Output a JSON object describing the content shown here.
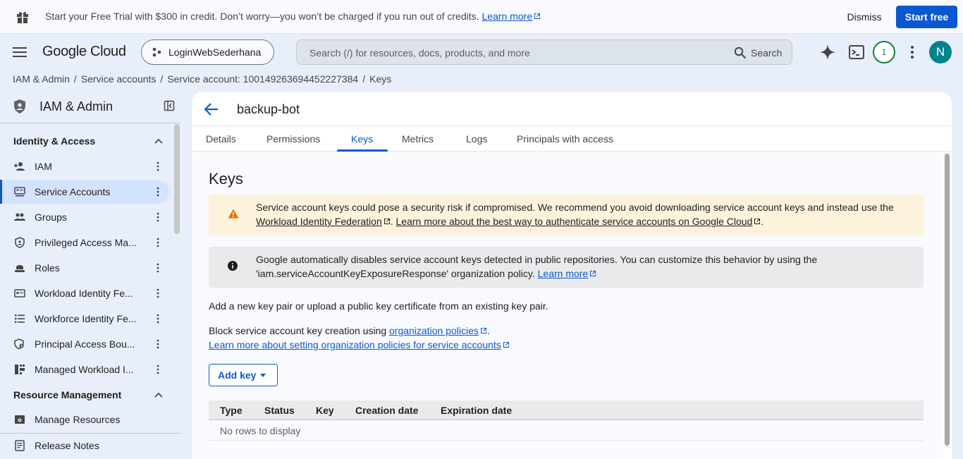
{
  "banner": {
    "text": "Start your Free Trial with $300 in credit. Don’t worry—you won’t be charged if you run out of credits.",
    "link": "Learn more",
    "dismiss": "Dismiss",
    "start": "Start free"
  },
  "header": {
    "logo": "Google Cloud",
    "project": "LoginWebSederhana",
    "search_placeholder": "Search (/) for resources, docs, products, and more",
    "search_button": "Search",
    "notifications": "1",
    "avatar": "N"
  },
  "breadcrumb": [
    "IAM & Admin",
    "Service accounts",
    "Service account: 100149263694452227384",
    "Keys"
  ],
  "sidebar": {
    "title": "IAM & Admin",
    "section1": "Identity & Access",
    "items": [
      {
        "label": "IAM",
        "icon": "person-add-icon"
      },
      {
        "label": "Service Accounts",
        "icon": "service-account-icon",
        "active": true
      },
      {
        "label": "Groups",
        "icon": "groups-icon"
      },
      {
        "label": "Privileged Access Ma...",
        "icon": "shield-icon"
      },
      {
        "label": "Roles",
        "icon": "roles-icon"
      },
      {
        "label": "Workload Identity Fe...",
        "icon": "workload-icon"
      },
      {
        "label": "Workforce Identity Fe...",
        "icon": "workforce-icon"
      },
      {
        "label": "Principal Access Bou...",
        "icon": "policy-icon"
      },
      {
        "label": "Managed Workload I...",
        "icon": "managed-icon"
      }
    ],
    "section2": "Resource Management",
    "item_manage": "Manage Resources",
    "release_notes": "Release Notes"
  },
  "main": {
    "title": "backup-bot",
    "tabs": [
      "Details",
      "Permissions",
      "Keys",
      "Metrics",
      "Logs",
      "Principals with access"
    ],
    "active_tab": "Keys",
    "heading": "Keys",
    "warning": {
      "line1": "Service account keys could pose a security risk if compromised. We recommend you avoid downloading service account keys and instead use the",
      "link1": "Workload Identity Federation",
      "link2": "Learn more about the best way to authenticate service accounts on Google Cloud"
    },
    "info": {
      "line1": "Google automatically disables service account keys detected in public repositories. You can customize this behavior by using the",
      "line2": "'iam.serviceAccountKeyExposureResponse' organization policy.",
      "link": "Learn more"
    },
    "para1": "Add a new key pair or upload a public key certificate from an existing key pair.",
    "para2": "Block service account key creation using",
    "para2_link": "organization policies",
    "para3_link": "Learn more about setting organization policies for service accounts",
    "add_key": "Add key",
    "table": {
      "columns": [
        "Type",
        "Status",
        "Key",
        "Creation date",
        "Expiration date"
      ],
      "empty": "No rows to display"
    }
  },
  "colors": {
    "accent": "#0b57d0",
    "warning_bg": "#fdf3dd",
    "warning_icon": "#e37400",
    "active_nav": "#d3e3fd"
  }
}
